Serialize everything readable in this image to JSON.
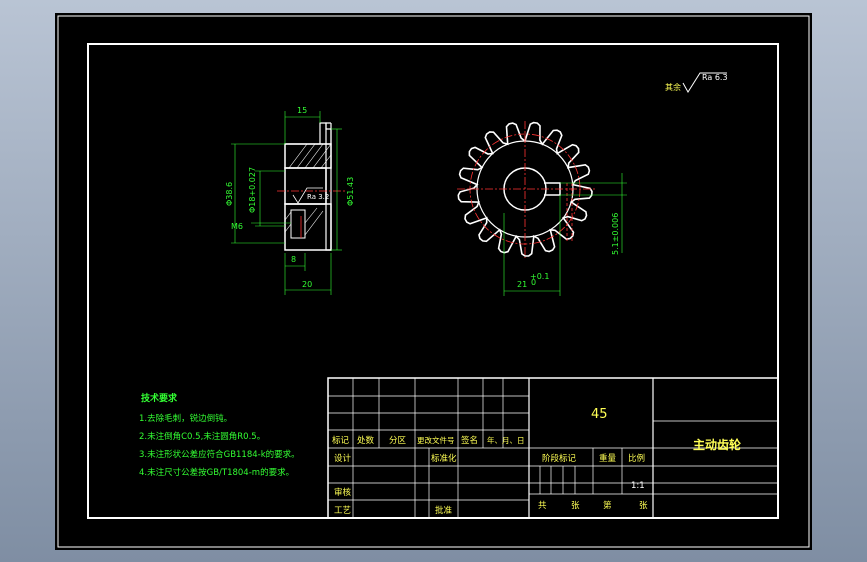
{
  "surface_roughness": {
    "prefix": "其余",
    "value": "Ra 6.3",
    "inner": "Ra 3.2"
  },
  "side_view": {
    "width_top": "15",
    "width_bottom": "20",
    "hub_len": "8",
    "outer_dia": "Φ51.43",
    "hub_dia": "Φ38.6",
    "bore": "Φ18+0.027",
    "thread": "M6"
  },
  "front_view": {
    "keyway_depth": "21",
    "keyway_tol": "+0.1",
    "keyway_tol_low": "0",
    "key_width": "5.1±0.006"
  },
  "tech_requirements": {
    "title": "技术要求",
    "items": [
      "1.去除毛刺，锐边倒钝。",
      "2.未注倒角C0.5,未注圆角R0.5。",
      "3.未注形状公差应符合GB1184-k的要求。",
      "4.未注尺寸公差按GB/T1804-m的要求。"
    ]
  },
  "title_block": {
    "material": "45",
    "part_name": "主动齿轮",
    "rev_headers": [
      "标记",
      "处数",
      "分区",
      "更改文件号",
      "签名",
      "年、月、日"
    ],
    "design": "设计",
    "standardize": "标准化",
    "check": "审核",
    "process": "工艺",
    "approve": "批准",
    "stage_mark": "阶段标记",
    "weight": "重量",
    "scale": "比例",
    "scale_value": "1:1",
    "total": "共",
    "sheets": "张",
    "page": "第",
    "sheets2": "张"
  }
}
